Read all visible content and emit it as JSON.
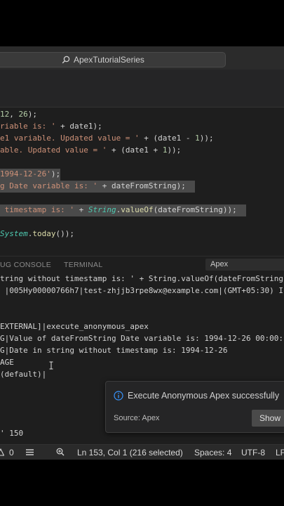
{
  "search": {
    "text": "ApexTutorialSeries"
  },
  "editor": {
    "lines": [
      [
        "12, 26);"
      ],
      [
        "riable is: ' + date1);"
      ],
      [
        "e1 variable. Updated value = ' + (date1 - 1));"
      ],
      [
        "able. Updated value = ' + (date1 + 1));"
      ],
      [
        ""
      ],
      [
        "1994-12-26');"
      ],
      [
        "g Date variable is: ' + dateFromString);"
      ],
      [
        ""
      ],
      [
        " timestamp is: ' + String.valueOf(dateFromString));"
      ],
      [
        ""
      ],
      [
        "System.today());"
      ]
    ],
    "line_texts": {
      "l1_num": "12",
      "l1_rest": ", ",
      "l1_num2": "26",
      "l1_end": ");",
      "l2_str": "riable is: '",
      "l2_rest": " + date1);",
      "l3_str": "e1 variable. Updated value = '",
      "l3_rest": " + (date1 - ",
      "l3_num": "1",
      "l3_end": "));",
      "l4_str": "able. Updated value = '",
      "l4_rest": " + (date1 + ",
      "l4_num": "1",
      "l4_end": "));",
      "l6_str": "1994-12-26'",
      "l6_end": ");",
      "l7_str": "g Date variable is: '",
      "l7_rest": " + dateFromString);",
      "l9_str": " timestamp is: '",
      "l9_rest": " + ",
      "l9_type": "String",
      "l9_dot": ".",
      "l9_fn": "valueOf",
      "l9_end": "(dateFromString));",
      "l11_type": "System",
      "l11_dot": ".",
      "l11_fn": "today",
      "l11_end": "());"
    }
  },
  "panel": {
    "tab_debug": "UG CONSOLE",
    "tab_terminal": "TERMINAL",
    "dropdown_value": "Apex"
  },
  "console": {
    "lines": [
      "tring without timestamp is: ' + String.valueOf(dateFromString",
      " |005Hy00000766h7|test-zhjjb3rpe8wx@example.com|(GMT+05:30) I",
      "",
      "",
      "EXTERNAL]|execute_anonymous_apex",
      "G|Value of dateFromString Date variable is: 1994-12-26 00:00:",
      "G|Date in string without timestamp is: 1994-12-26",
      "AGE",
      "(default)|",
      "",
      "",
      "",
      "",
      "",
      "' 150"
    ]
  },
  "toast": {
    "message": "Execute Anonymous Apex successfully",
    "source": "Source: Apex",
    "button": "Show"
  },
  "statusbar": {
    "errors": "0",
    "position": "Ln 153, Col 1 (216 selected)",
    "spaces": "Spaces: 4",
    "encoding": "UTF-8",
    "eol": "LF"
  }
}
